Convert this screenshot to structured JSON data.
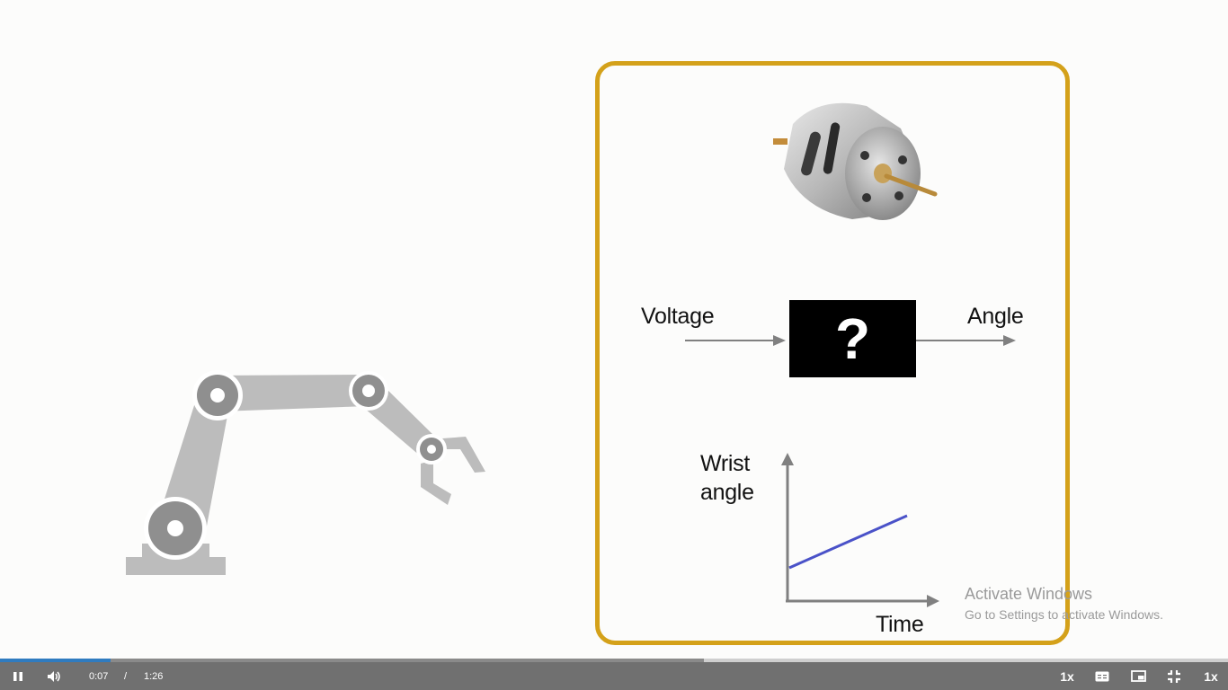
{
  "diagram": {
    "input_label": "Voltage",
    "output_label": "Angle",
    "box_symbol": "?",
    "plot": {
      "y_label_line1": "Wrist",
      "y_label_line2": "angle",
      "x_label": "Time",
      "series_color": "#4a52c8"
    },
    "frame_color": "#d4a11a"
  },
  "watermark": {
    "title": "Activate Windows",
    "subtitle": "Go to Settings to activate Windows."
  },
  "player": {
    "current_time": "0:07",
    "separator": "/",
    "duration": "1:26",
    "speed_label": "1x",
    "speed_label_right": "1x",
    "played_fraction": 0.09,
    "buffered_fraction": 0.573,
    "icons": [
      "pause-icon",
      "volume-icon",
      "captions-icon",
      "picture-in-picture-icon",
      "exit-fullscreen-icon"
    ],
    "progress_color": "#2f7bbf"
  }
}
